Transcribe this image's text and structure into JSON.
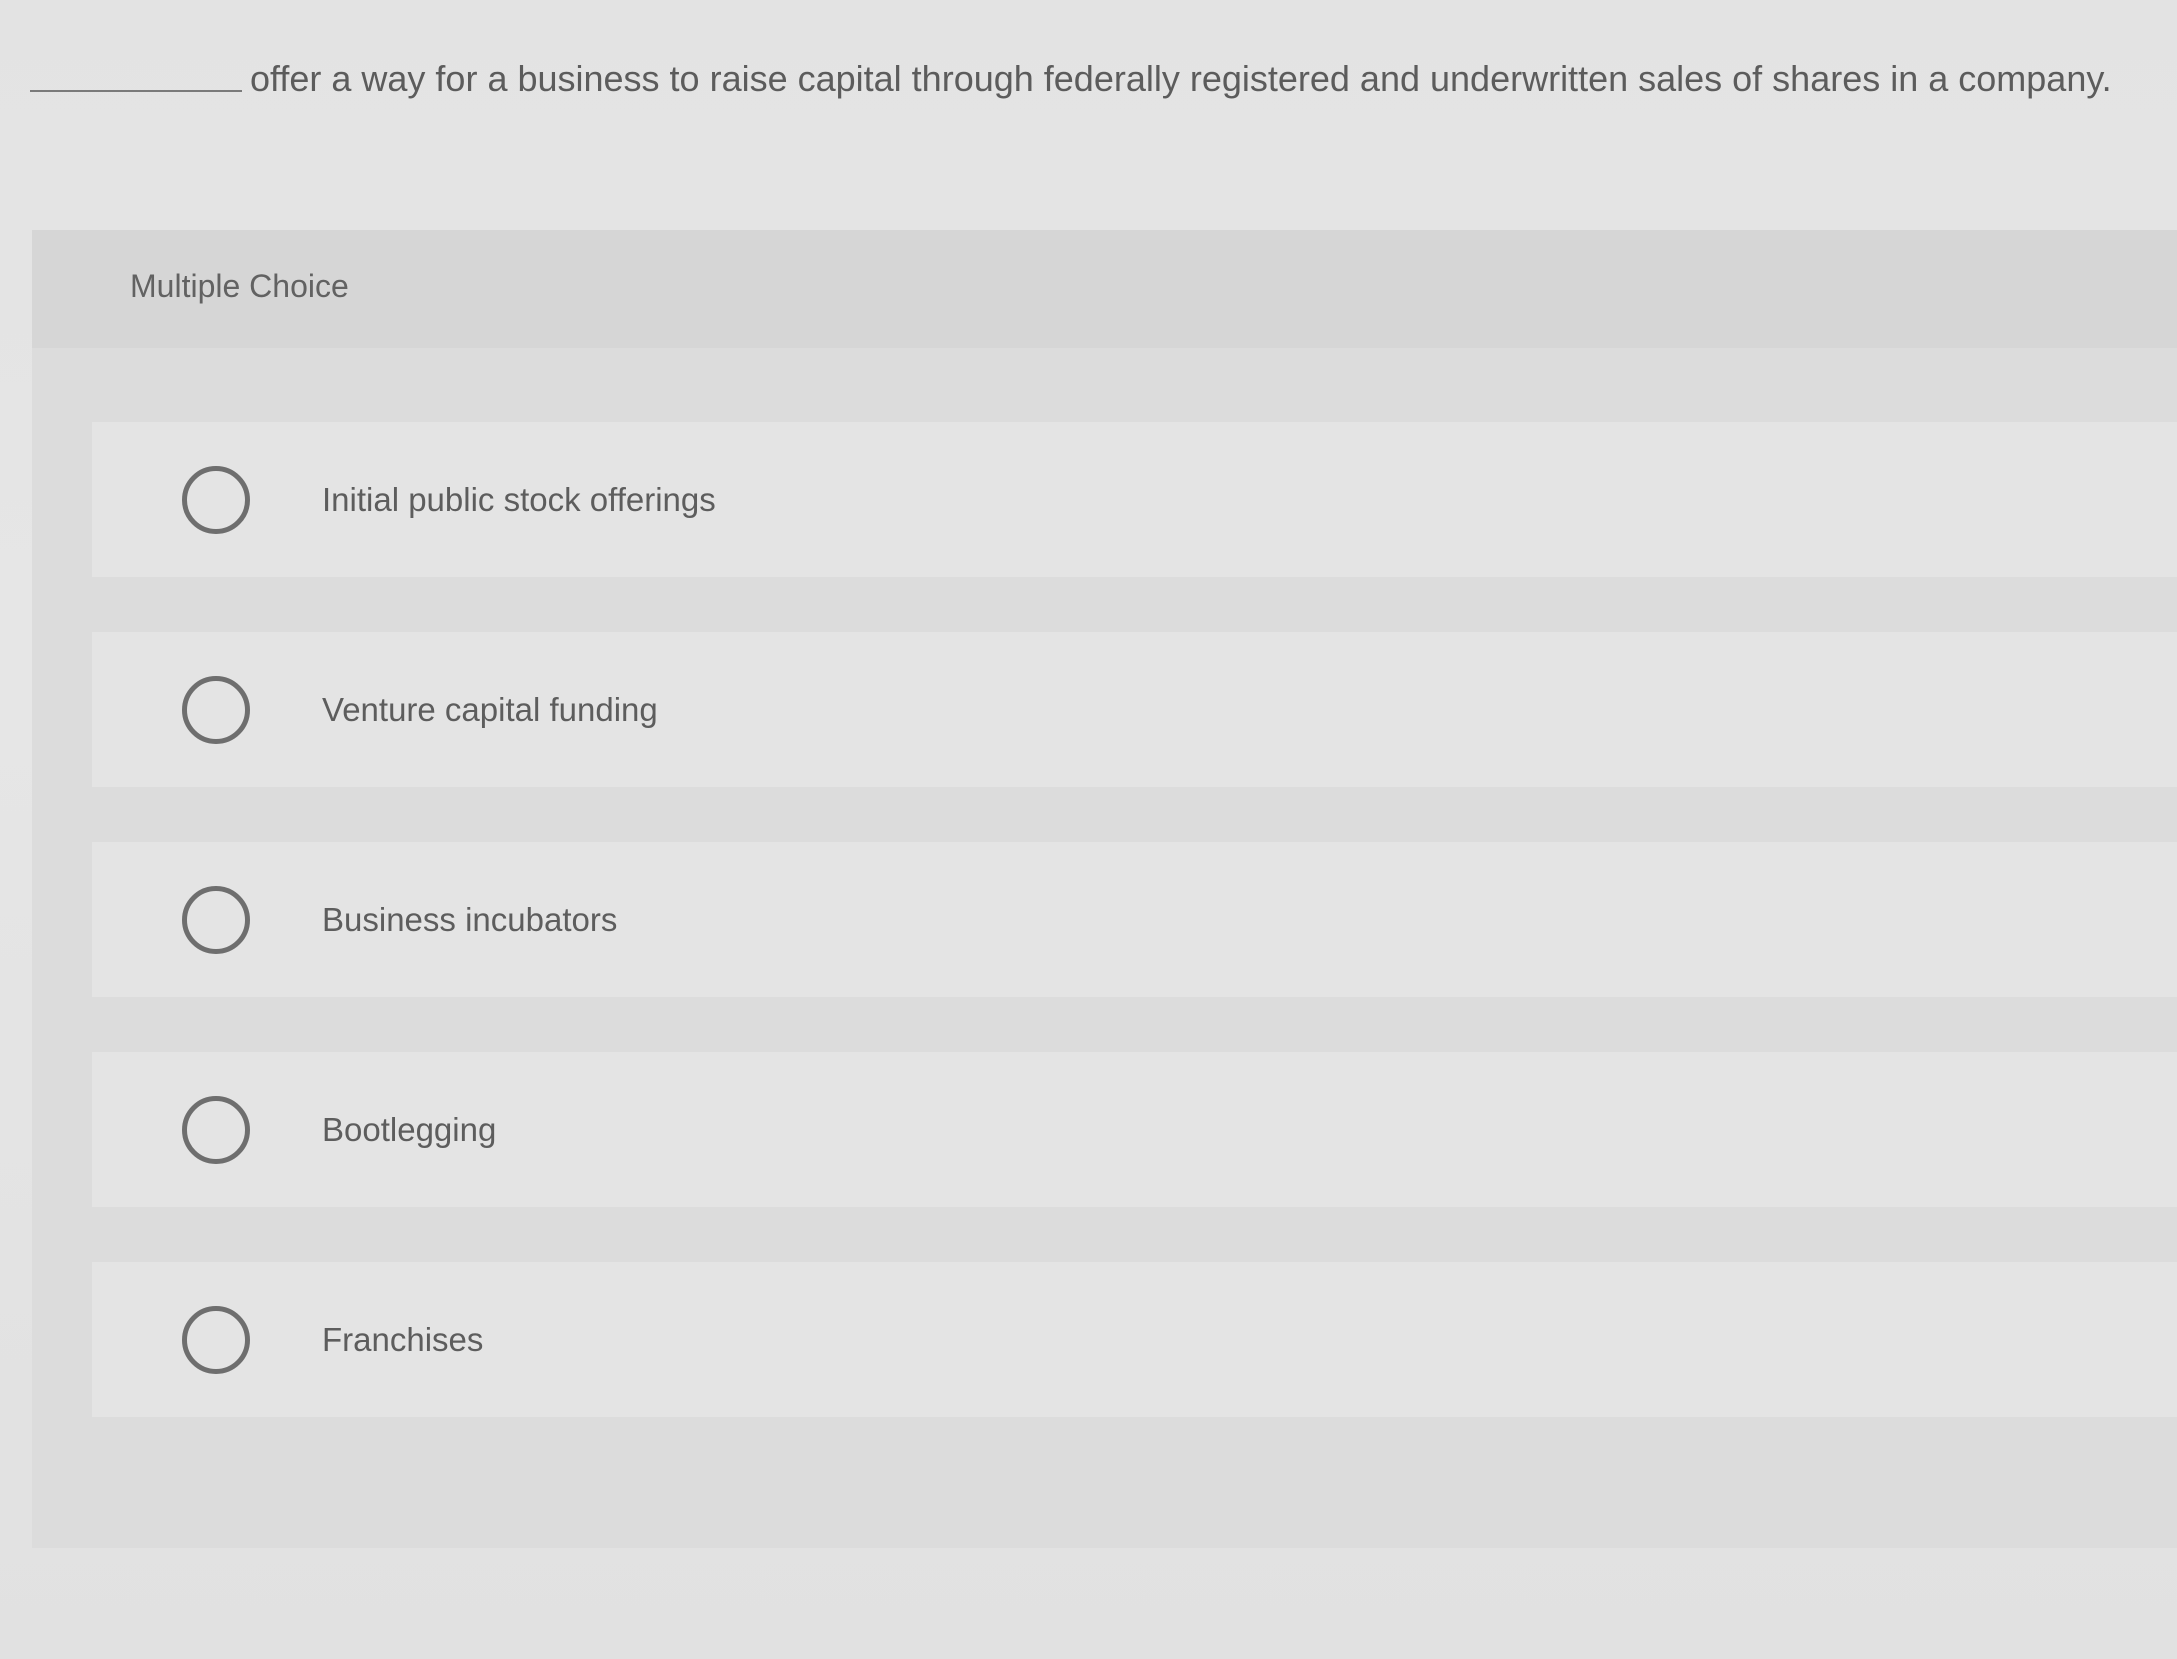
{
  "question": {
    "blank": "",
    "text": "offer a way for a business to raise capital through federally registered and underwritten sales of shares in a company."
  },
  "panel": {
    "label": "Multiple Choice"
  },
  "choices": [
    {
      "label": "Initial public stock offerings",
      "selected": false
    },
    {
      "label": "Venture capital funding",
      "selected": false
    },
    {
      "label": "Business incubators",
      "selected": false
    },
    {
      "label": "Bootlegging",
      "selected": false
    },
    {
      "label": "Franchises",
      "selected": false
    }
  ]
}
